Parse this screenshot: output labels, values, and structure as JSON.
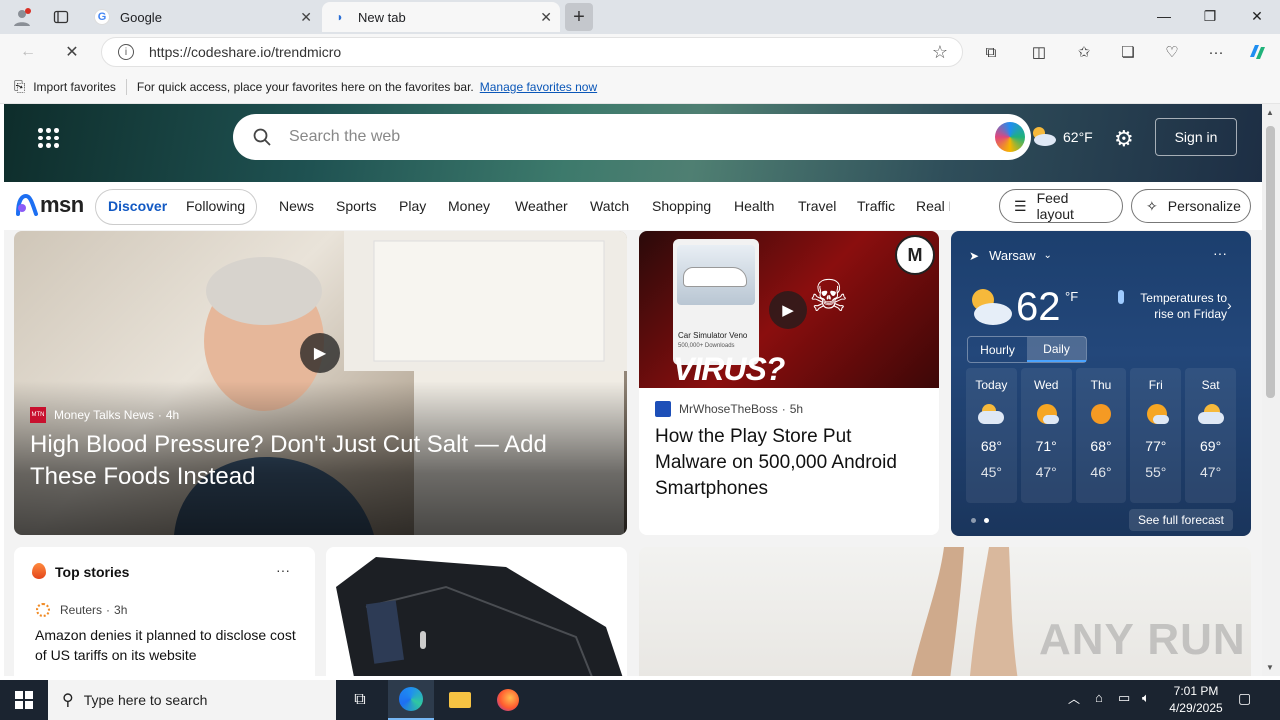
{
  "browser": {
    "tabs": [
      {
        "title": "Google",
        "active": false
      },
      {
        "title": "New tab",
        "active": true
      }
    ],
    "url": "https://codeshare.io/trendmicro",
    "favorites_bar": {
      "import_label": "Import favorites",
      "hint": "For quick access, place your favorites here on the favorites bar.",
      "manage_link": "Manage favorites now"
    }
  },
  "msn": {
    "search_placeholder": "Search the web",
    "header_temp": "62°F",
    "sign_in": "Sign in",
    "logo": "msn",
    "feed_tabs": [
      "Discover",
      "Following"
    ],
    "nav_links": [
      "News",
      "Sports",
      "Play",
      "Money",
      "Weather",
      "Watch",
      "Shopping",
      "Health",
      "Travel",
      "Traffic",
      "Real E"
    ],
    "feed_layout": "Feed layout",
    "personalize": "Personalize",
    "hero_story": {
      "source": "Money Talks News",
      "source_badge": "MTN",
      "age": "4h",
      "headline": "High Blood Pressure? Don't Just Cut Salt — Add These Foods Instead"
    },
    "second_story": {
      "source": "MrWhoseTheBoss",
      "age": "5h",
      "headline": "How the Play Store Put Malware on 500,000 Android Smartphones",
      "thumb_text": "VIRUS?",
      "thumb_app_name": "Car Simulator Veno",
      "thumb_downloads": "500,000+ Downloads"
    },
    "weather": {
      "location": "Warsaw",
      "temp": "62",
      "unit": "°F",
      "note": "Temperatures to rise on Friday",
      "tabs": [
        "Hourly",
        "Daily"
      ],
      "days": [
        {
          "day": "Today",
          "high": "68°",
          "low": "45°",
          "icon": "partly-cloudy-icon"
        },
        {
          "day": "Wed",
          "high": "71°",
          "low": "47°",
          "icon": "mostly-sunny-icon"
        },
        {
          "day": "Thu",
          "high": "68°",
          "low": "46°",
          "icon": "sunny-icon"
        },
        {
          "day": "Fri",
          "high": "77°",
          "low": "55°",
          "icon": "mostly-sunny-icon"
        },
        {
          "day": "Sat",
          "high": "69°",
          "low": "47°",
          "icon": "partly-sunny-icon"
        }
      ],
      "see_full": "See full forecast"
    },
    "top_stories": {
      "title": "Top stories",
      "source": "Reuters",
      "age": "3h",
      "headline": "Amazon denies it planned to disclose cost of US tariffs on its website"
    },
    "watermark": "ANY RUN"
  },
  "taskbar": {
    "search_placeholder": "Type here to search",
    "time": "7:01 PM",
    "date": "4/29/2025"
  }
}
